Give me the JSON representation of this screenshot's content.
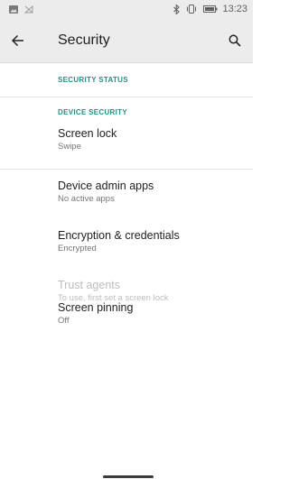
{
  "status_bar": {
    "time": "13:23",
    "icons": [
      "image-icon",
      "signal-off-icon",
      "bluetooth-icon",
      "vibrate-icon",
      "battery-icon"
    ]
  },
  "app_bar": {
    "title": "Security",
    "back_icon": "arrow-back-icon",
    "search_icon": "search-icon"
  },
  "sections": {
    "security_status": "SECURITY STATUS",
    "device_security": "DEVICE SECURITY"
  },
  "preferences": {
    "screen_lock": {
      "title": "Screen lock",
      "summary": "Swipe"
    },
    "device_admin": {
      "title": "Device admin apps",
      "summary": "No active apps"
    },
    "encryption": {
      "title": "Encryption & credentials",
      "summary": "Encrypted"
    },
    "trust_agents": {
      "title": "Trust agents",
      "summary": "To use, first set a screen lock"
    },
    "screen_pinning": {
      "title": "Screen pinning",
      "summary": "Off"
    }
  },
  "colors": {
    "accent": "#2a8c84",
    "app_bar_bg": "#ececec",
    "disabled_text": "#bdbdbd"
  }
}
